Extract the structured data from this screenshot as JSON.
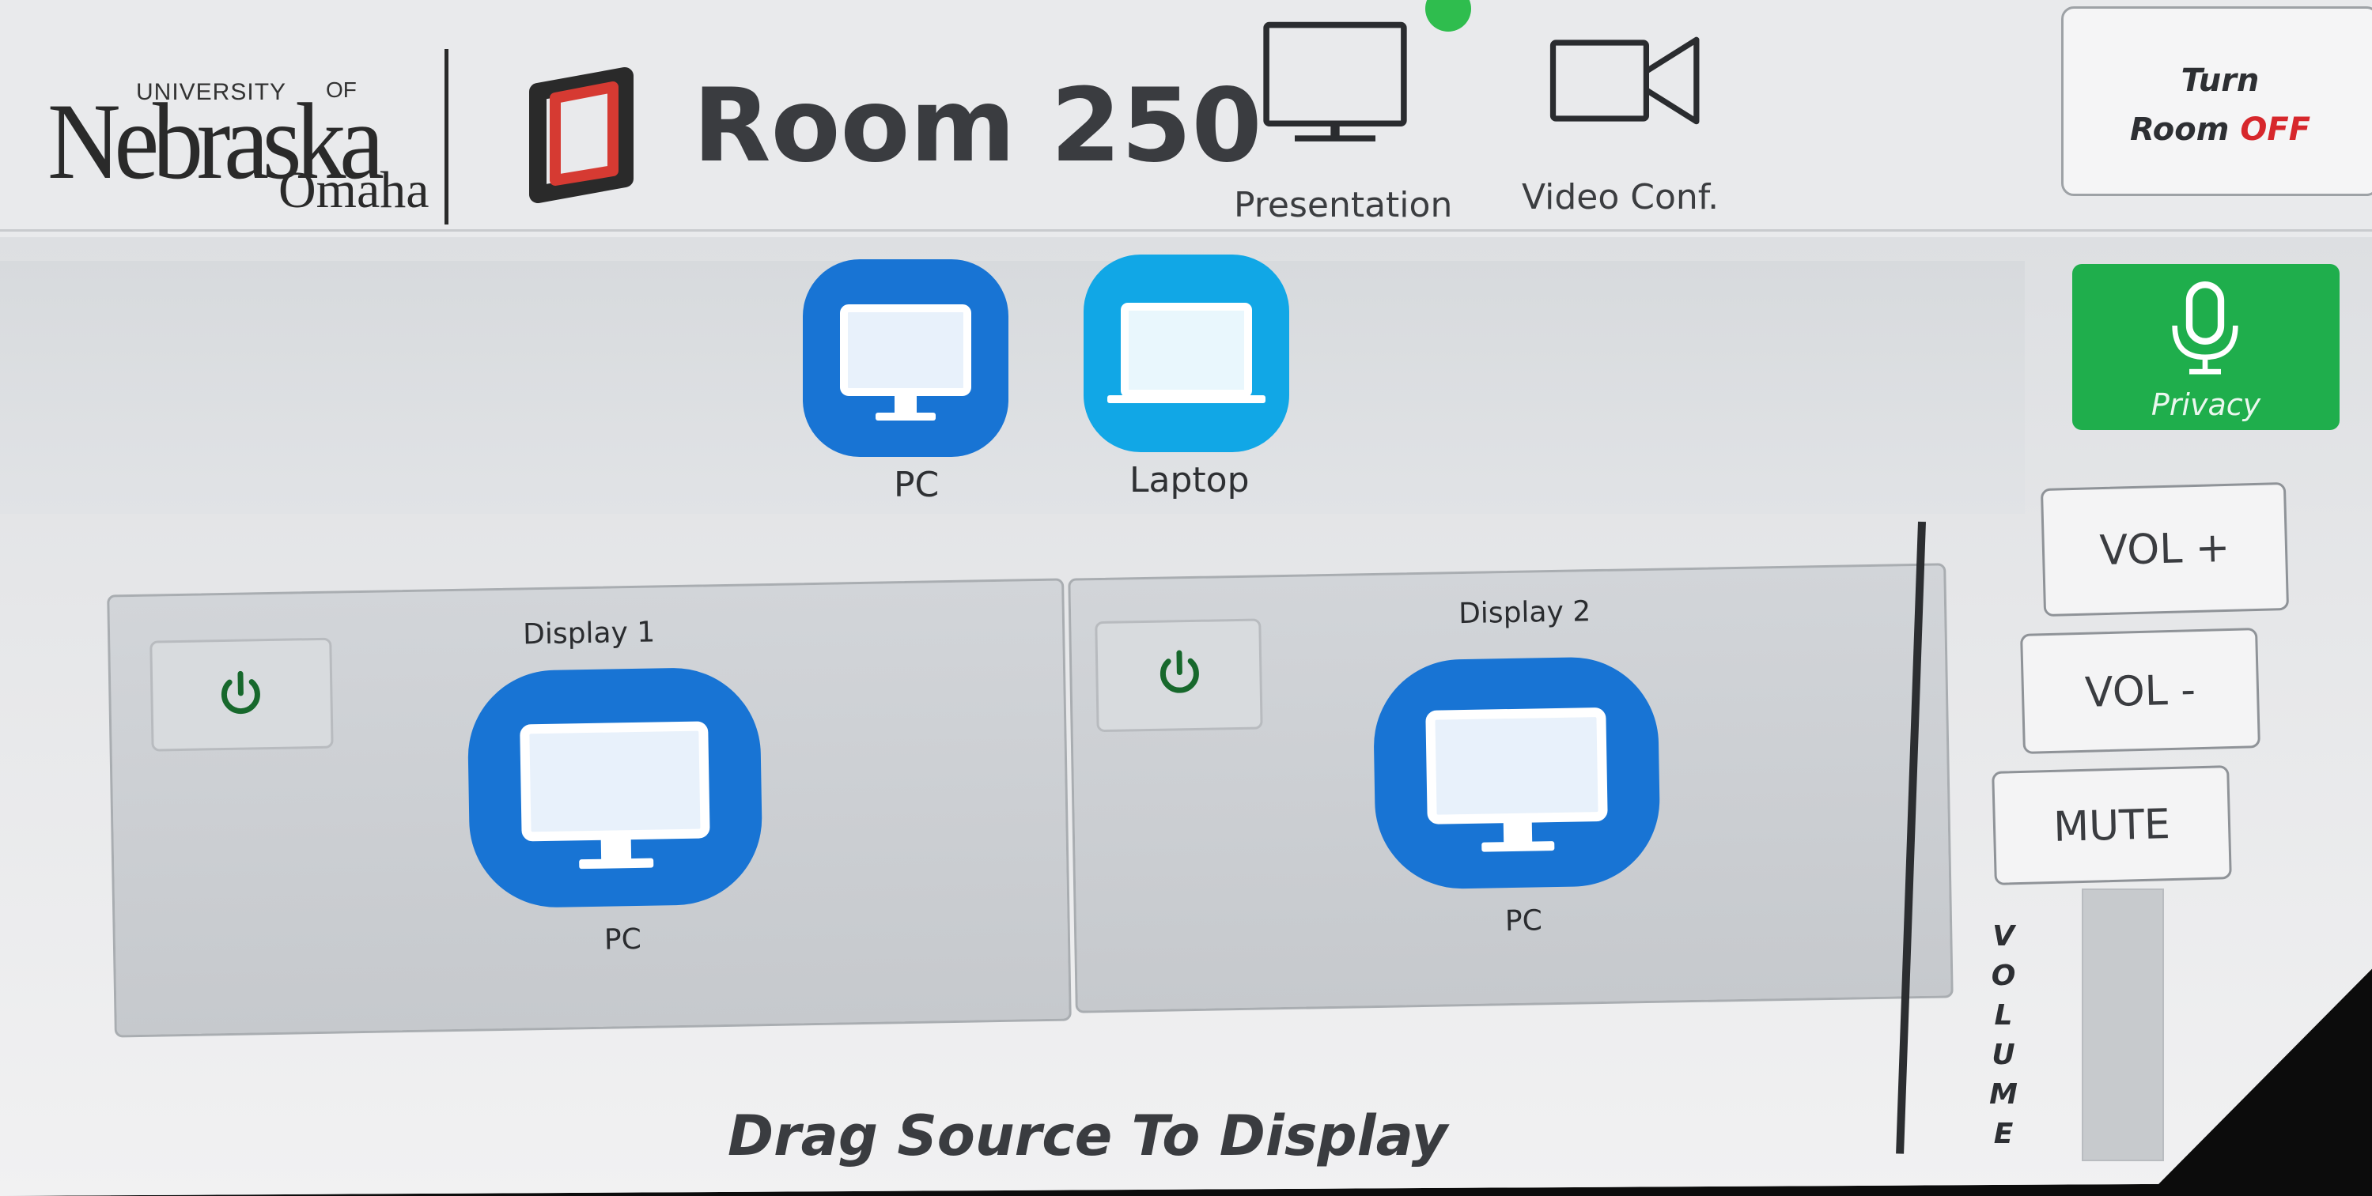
{
  "header": {
    "logo": {
      "university": "UNIVERSITY",
      "of": "OF",
      "name": "Nebraska",
      "city": "Omaha"
    },
    "room_title": "Room 250",
    "modes": [
      {
        "label": "Presentation",
        "icon": "monitor-icon",
        "active": true
      },
      {
        "label": "Video Conf.",
        "icon": "video-camera-icon",
        "active": false
      }
    ],
    "power": {
      "line1": "Turn",
      "line2_prefix": "Room ",
      "line2_state": "OFF"
    }
  },
  "sources": [
    {
      "label": "PC",
      "icon": "desktop-monitor-icon",
      "color": "#1874d4"
    },
    {
      "label": "Laptop",
      "icon": "laptop-icon",
      "color": "#11a7e6"
    }
  ],
  "privacy": {
    "label": "Privacy",
    "icon": "microphone-icon",
    "color": "#1fae4c"
  },
  "displays": [
    {
      "title": "Display 1",
      "source": "PC",
      "power_icon": "power-icon"
    },
    {
      "title": "Display 2",
      "source": "PC",
      "power_icon": "power-icon"
    }
  ],
  "volume": {
    "vol_up": "VOL +",
    "vol_down": "VOL -",
    "mute": "MUTE",
    "label": "VOLUME",
    "letters": [
      "V",
      "O",
      "L",
      "U",
      "M",
      "E"
    ],
    "level": 0
  },
  "instruction": "Drag Source To Display",
  "colors": {
    "accent_blue": "#1874d4",
    "laptop_blue": "#11a7e6",
    "privacy_green": "#1fae4c",
    "status_green": "#2fbd4e",
    "off_red": "#d7272c",
    "logo_red": "#d63a32"
  }
}
